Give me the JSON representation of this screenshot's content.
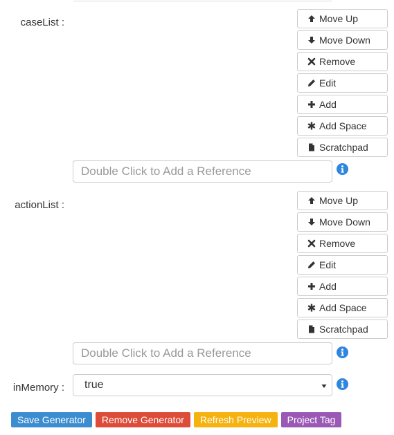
{
  "fields": {
    "case_list": {
      "label": "caseList :",
      "buttons": [
        {
          "icon": "arrow-up-icon",
          "label": "Move Up"
        },
        {
          "icon": "arrow-down-icon",
          "label": "Move Down"
        },
        {
          "icon": "remove-icon",
          "label": "Remove"
        },
        {
          "icon": "pencil-icon",
          "label": "Edit"
        },
        {
          "icon": "plus-icon",
          "label": "Add"
        },
        {
          "icon": "asterisk-icon",
          "label": "Add Space"
        },
        {
          "icon": "file-icon",
          "label": "Scratchpad"
        }
      ],
      "reference_placeholder": "Double Click to Add a Reference"
    },
    "action_list": {
      "label": "actionList :",
      "buttons": [
        {
          "icon": "arrow-up-icon",
          "label": "Move Up"
        },
        {
          "icon": "arrow-down-icon",
          "label": "Move Down"
        },
        {
          "icon": "remove-icon",
          "label": "Remove"
        },
        {
          "icon": "pencil-icon",
          "label": "Edit"
        },
        {
          "icon": "plus-icon",
          "label": "Add"
        },
        {
          "icon": "asterisk-icon",
          "label": "Add Space"
        },
        {
          "icon": "file-icon",
          "label": "Scratchpad"
        }
      ],
      "reference_placeholder": "Double Click to Add a Reference"
    },
    "in_memory": {
      "label": "inMemory :",
      "selected_value": "true"
    }
  },
  "actions": {
    "save_generator": {
      "label": "Save Generator",
      "color": "#3c8dd0"
    },
    "remove_generator": {
      "label": "Remove Generator",
      "color": "#dd4b39"
    },
    "refresh_preview": {
      "label": "Refresh Preview",
      "color": "#f6b20e"
    },
    "project_tag": {
      "label": "Project Tag",
      "color": "#9b59b6"
    }
  },
  "colors": {
    "info_icon": "#2e86de"
  }
}
